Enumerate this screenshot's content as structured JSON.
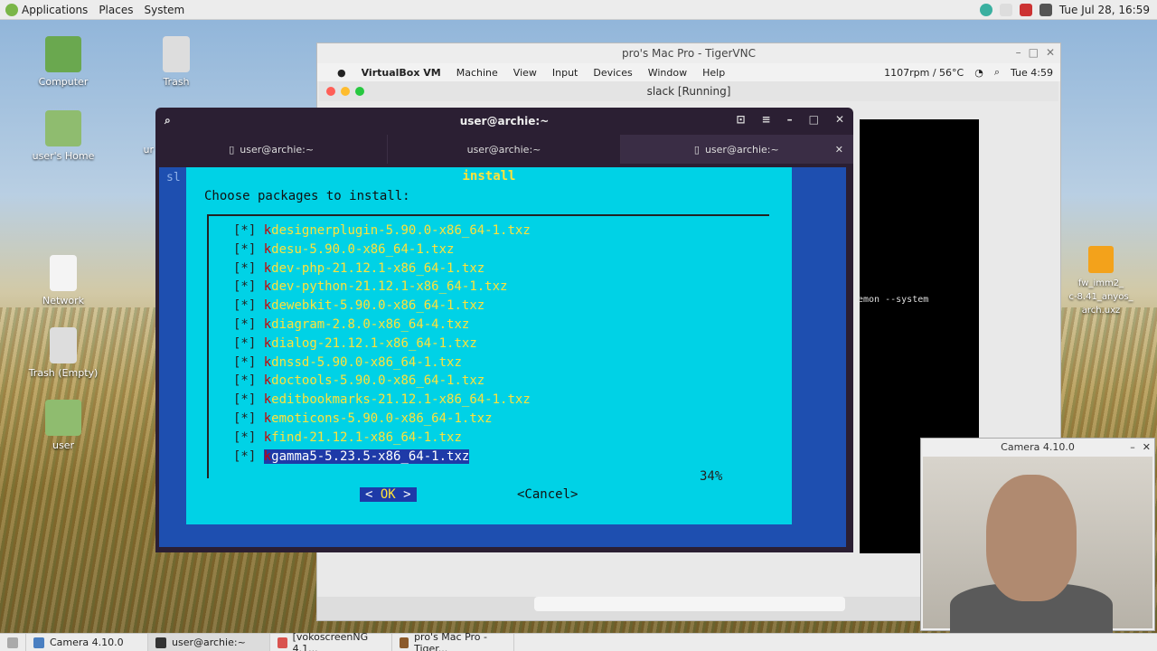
{
  "topbar": {
    "applications": "Applications",
    "places": "Places",
    "system": "System",
    "clock": "Tue Jul 28, 16:59"
  },
  "desktop": {
    "icons": [
      "Computer",
      "Trash",
      "user's Home",
      "Network",
      "Trash (Empty)",
      "user"
    ],
    "right_file_lines": [
      "fw_imm2_",
      "c-8.41_anyos_",
      "arch.uxz"
    ],
    "partial_label": "ur"
  },
  "vnc": {
    "title": "pro's Mac Pro - TigerVNC",
    "mac_menu": [
      "VirtualBox VM",
      "Machine",
      "View",
      "Input",
      "Devices",
      "Window",
      "Help"
    ],
    "mac_status": "1107rpm / 56°C",
    "mac_clock": "Tue 4:59",
    "vb_window": "slack [Running]",
    "behind_text": "emon --system"
  },
  "terminal": {
    "title": "user@archie:~",
    "tabs": [
      "user@archie:~",
      "user@archie:~",
      "user@archie:~"
    ],
    "left_fragment": "sl"
  },
  "dialog": {
    "title": "install",
    "prompt": "Choose packages to install:",
    "checkbox": "[*]",
    "packages": [
      "kdesignerplugin-5.90.0-x86_64-1.txz",
      "kdesu-5.90.0-x86_64-1.txz",
      "kdev-php-21.12.1-x86_64-1.txz",
      "kdev-python-21.12.1-x86_64-1.txz",
      "kdewebkit-5.90.0-x86_64-1.txz",
      "kdiagram-2.8.0-x86_64-4.txz",
      "kdialog-21.12.1-x86_64-1.txz",
      "kdnssd-5.90.0-x86_64-1.txz",
      "kdoctools-5.90.0-x86_64-1.txz",
      "keditbookmarks-21.12.1-x86_64-1.txz",
      "kemoticons-5.90.0-x86_64-1.txz",
      "kfind-21.12.1-x86_64-1.txz",
      "kgamma5-5.23.5-x86_64-1.txz"
    ],
    "progress": "34%",
    "ok": "OK",
    "ok_left": "<",
    "ok_right": ">",
    "cancel": "<Cancel>"
  },
  "camera": {
    "title": "Camera 4.10.0"
  },
  "taskbar": {
    "items": [
      "Camera 4.10.0",
      "user@archie:~",
      "[vokoscreenNG 4.1...",
      "pro's Mac Pro - Tiger..."
    ]
  }
}
